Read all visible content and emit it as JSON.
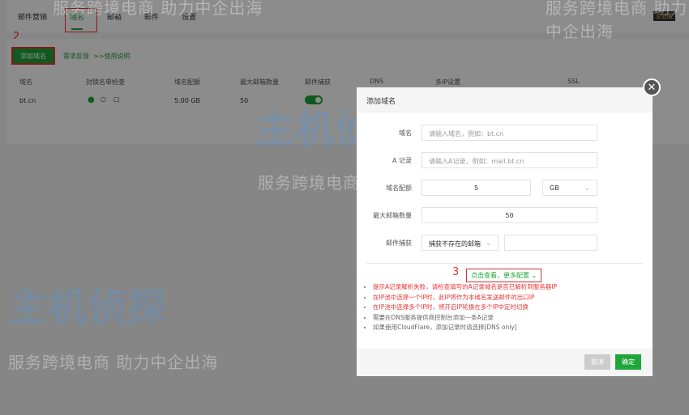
{
  "tabs": [
    {
      "label": "邮件营销"
    },
    {
      "label": "域名"
    },
    {
      "label": "邮箱"
    },
    {
      "label": "邮件"
    },
    {
      "label": "设置"
    }
  ],
  "badge": "企业版",
  "step_labels": {
    "two": "2",
    "three": "3"
  },
  "toolbar": {
    "add_domain": "添加域名",
    "feedback": "需求反馈",
    "usage": ">>使用说明"
  },
  "table": {
    "headers": [
      "域名",
      "封锁名单检查",
      "域名配额",
      "最大邮箱数量",
      "邮件捕获",
      "DNS",
      "多IP设置",
      "SSL"
    ],
    "rows": [
      {
        "domain": "bt.cn",
        "quota": "5.00 GB",
        "max": "50"
      }
    ]
  },
  "dialog": {
    "title": "添加域名",
    "fields": {
      "domain_label": "域名",
      "domain_placeholder": "请输入域名，例如：bt.cn",
      "a_label": "A 记录",
      "a_placeholder": "请输入A记录，例如：mail.bt.cn",
      "quota_label": "域名配额",
      "quota_value": "5",
      "quota_unit": "GB",
      "max_label": "最大邮箱数量",
      "max_value": "50",
      "catch_label": "邮件捕获",
      "catch_value": "捕获不存在的邮箱"
    },
    "more": "点击查看，更多配置",
    "tips": [
      {
        "text": "提示A记录解析失败，请检查填写的A记录域名是否已解析到服务器IP",
        "color": "#e33"
      },
      {
        "text": "在IP池中选择一个IP时，此IP将作为本域名发送邮件的出口IP",
        "color": "#e33"
      },
      {
        "text": "在IP池中选择多个IP时，将开启IP轮换在多个IP中定时切换",
        "color": "#e33"
      },
      {
        "text": "需要在DNS服务提供商控制台添加一条A记录",
        "color": "#666"
      },
      {
        "text": "如果使用CloudFlare，添加记录时请选择[DNS only]",
        "color": "#666"
      }
    ],
    "cancel": "取消",
    "confirm": "确定"
  },
  "watermark": {
    "slogan": "服务跨境电商 助力中企出海",
    "logo": "主机侦探"
  },
  "accent": "#20a53a"
}
